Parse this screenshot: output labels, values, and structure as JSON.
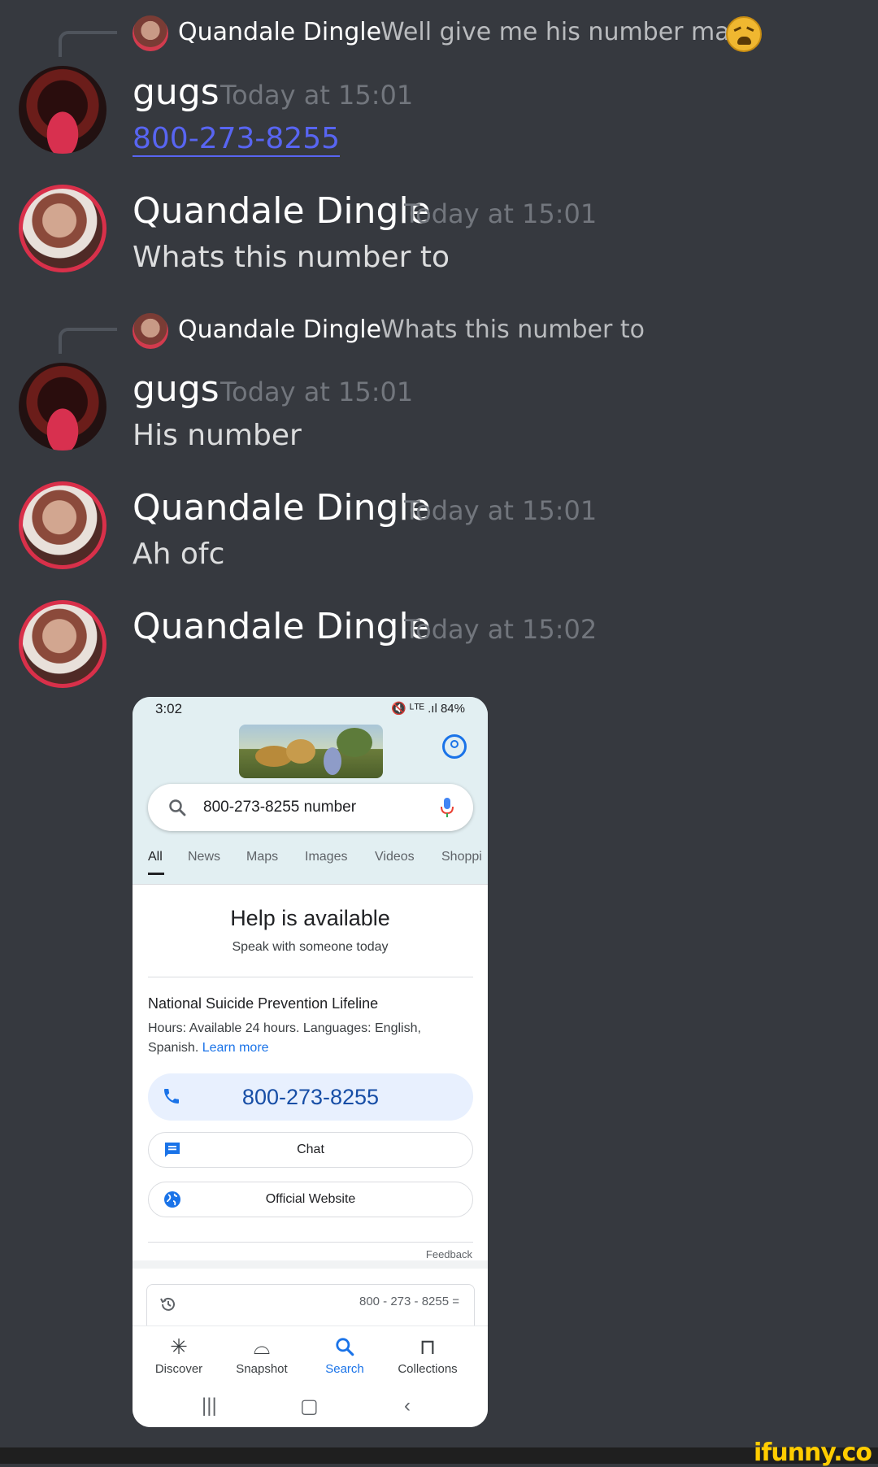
{
  "messages": [
    {
      "reply": {
        "author": "Quandale Dingle",
        "text": "Well give me his number man"
      },
      "author": "gugs",
      "time": "Today at 15:01",
      "link": "800-273-8255"
    },
    {
      "author": "Quandale Dingle",
      "time": "Today at 15:01",
      "text": "Whats this number to"
    },
    {
      "reply": {
        "author": "Quandale Dingle",
        "text": "Whats this number to"
      },
      "author": "gugs",
      "time": "Today at 15:01",
      "text": "His number"
    },
    {
      "author": "Quandale Dingle",
      "time": "Today at 15:01",
      "text": "Ah ofc"
    },
    {
      "author": "Quandale Dingle",
      "time": "Today at 15:02"
    }
  ],
  "phone": {
    "status_time": "3:02",
    "status_right": "🔇 ᴸᵀᴱ .ıl 84%",
    "search_query": "800-273-8255 number",
    "tabs": [
      "All",
      "News",
      "Maps",
      "Images",
      "Videos",
      "Shoppi"
    ],
    "help_title": "Help is available",
    "help_subtitle": "Speak with someone today",
    "org_name": "National Suicide Prevention Lifeline",
    "hours_text": "Hours: Available 24 hours. Languages: English, Spanish.",
    "learn_more": "Learn more",
    "call_number": "800-273-8255",
    "chat_label": "Chat",
    "website_label": "Official Website",
    "feedback": "Feedback",
    "calc_text": "800 - 273 - 8255 =",
    "nav": [
      "Discover",
      "Snapshot",
      "Search",
      "Collections"
    ],
    "nav_icons": [
      "discover-icon",
      "snapshot-icon",
      "search-icon",
      "collections-icon"
    ]
  },
  "watermark": "ifunny.co",
  "colors": {
    "background": "#36393f",
    "link": "#5865f2",
    "timestamp": "#72767d",
    "ring": "#d9304a"
  }
}
